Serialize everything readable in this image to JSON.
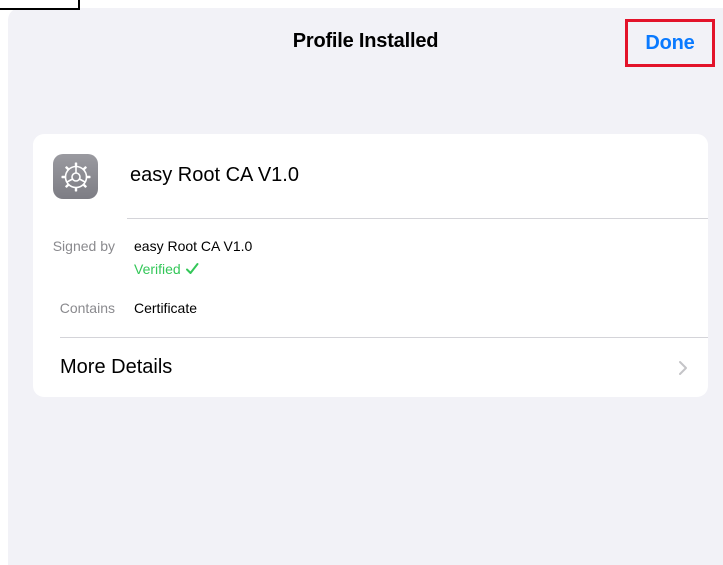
{
  "nav": {
    "title": "Profile Installed",
    "done_label": "Done"
  },
  "profile": {
    "icon": "settings-gear-icon",
    "name": "easy Root CA V1.0"
  },
  "details": {
    "signed_by_label": "Signed by",
    "signed_by_value": "easy Root CA V1.0",
    "verified_label": "Verified",
    "verified_icon": "checkmark-icon",
    "contains_label": "Contains",
    "contains_value": "Certificate"
  },
  "more": {
    "label": "More Details",
    "icon": "chevron-right-icon"
  },
  "colors": {
    "accent": "#0a7aff",
    "verified": "#34c759",
    "highlight_border": "#e3132a",
    "background": "#f2f2f7"
  }
}
